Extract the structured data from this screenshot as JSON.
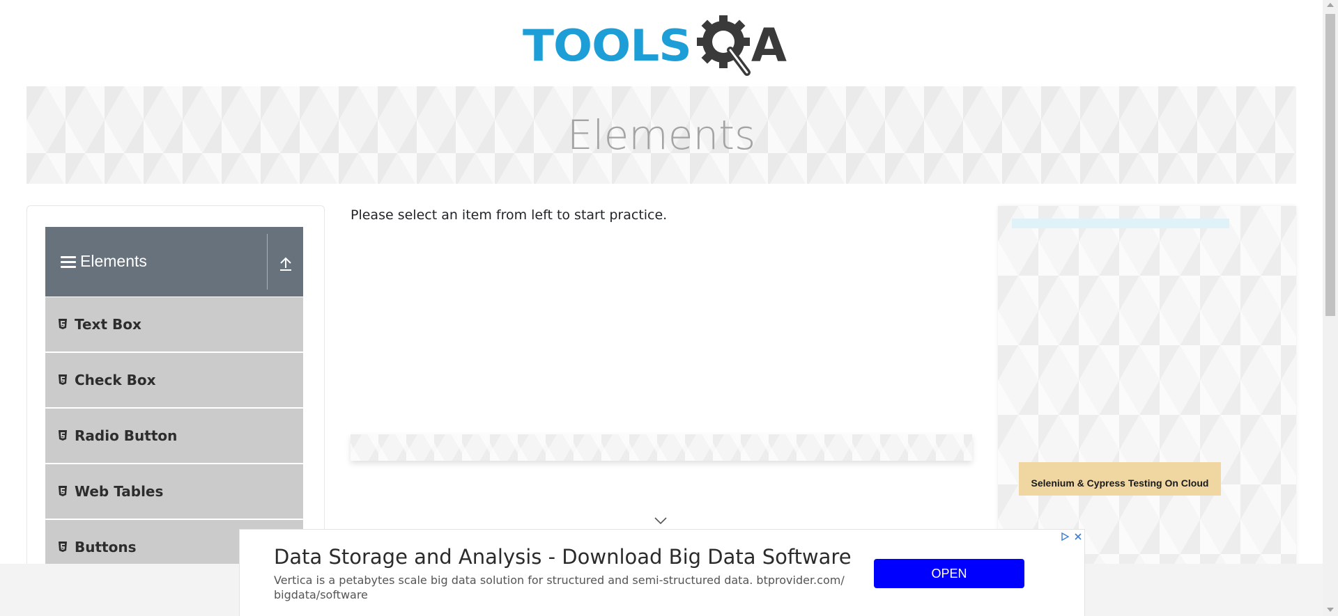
{
  "header": {
    "logo_text_left": "TOOLS",
    "logo_text_right": "A",
    "logo_icon": "gear-magnifier-icon"
  },
  "banner": {
    "title": "Elements"
  },
  "sidebar": {
    "group": {
      "label": "Elements",
      "icon": "hamburger-icon",
      "collapse_icon": "upload-arrow-icon"
    },
    "items": [
      {
        "label": "Text Box",
        "icon": "html5-icon"
      },
      {
        "label": "Check Box",
        "icon": "html5-icon"
      },
      {
        "label": "Radio Button",
        "icon": "html5-icon"
      },
      {
        "label": "Web Tables",
        "icon": "html5-icon"
      },
      {
        "label": "Buttons",
        "icon": "html5-icon"
      }
    ]
  },
  "main": {
    "intro_text": "Please select an item from left to start practice."
  },
  "right_panel": {
    "promo_text": "Selenium & Cypress Testing On Cloud"
  },
  "bottom_ad": {
    "headline": "Data Storage and Analysis - Download Big Data Software",
    "description": "Vertica is a petabytes scale big data solution for structured and semi-structured data. btprovider.com/ bigdata/software",
    "button_label": "OPEN",
    "button_color": "#0000ff",
    "adchoices_icon": "adchoices-icon",
    "close_icon": "close-icon"
  },
  "colors": {
    "brand_blue": "#1e9ed7",
    "brand_dark": "#3a3a3a",
    "sidebar_header": "#67727c",
    "sidebar_item": "#cbcbcb"
  }
}
